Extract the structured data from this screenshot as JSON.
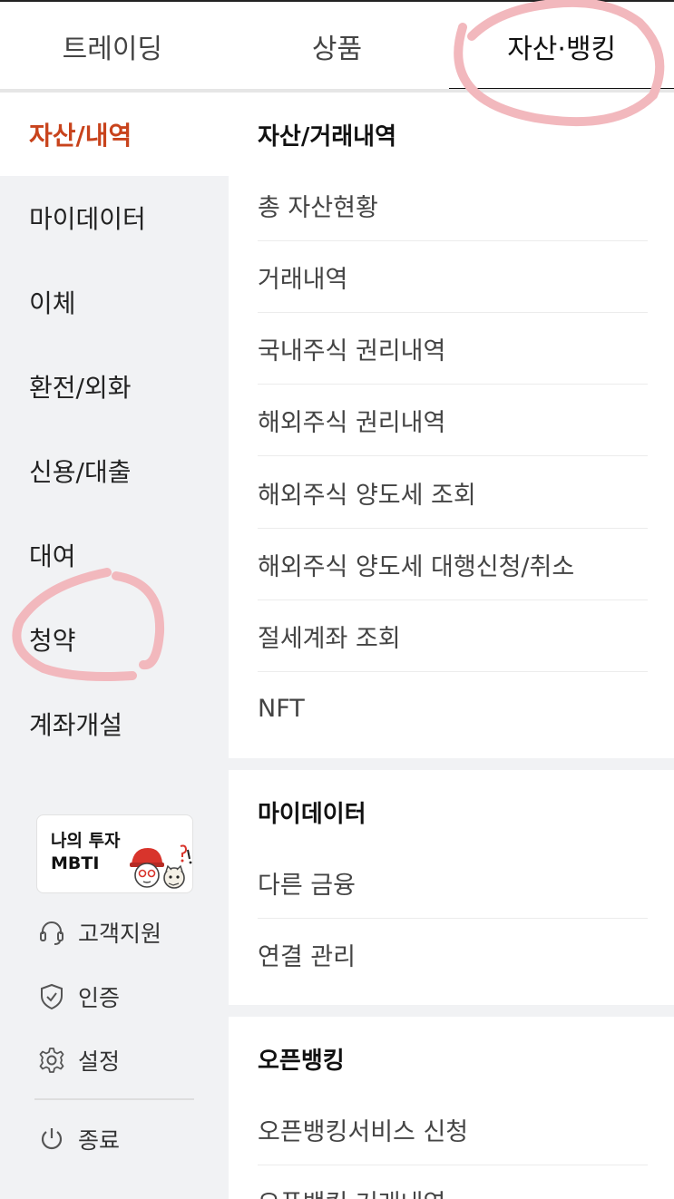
{
  "tabs": [
    {
      "label": "트레이딩"
    },
    {
      "label": "상품"
    },
    {
      "label": "자산·뱅킹"
    }
  ],
  "sidebar": {
    "items": [
      {
        "label": "자산/내역"
      },
      {
        "label": "마이데이터"
      },
      {
        "label": "이체"
      },
      {
        "label": "환전/외화"
      },
      {
        "label": "신용/대출"
      },
      {
        "label": "대여"
      },
      {
        "label": "청약"
      },
      {
        "label": "계좌개설"
      }
    ],
    "mbti": {
      "line1": "나의 투자",
      "line2": "MBTI"
    },
    "utilities": [
      {
        "label": "고객지원",
        "icon": "headset-icon"
      },
      {
        "label": "인증",
        "icon": "shield-check-icon"
      },
      {
        "label": "설정",
        "icon": "gear-icon"
      },
      {
        "label": "종료",
        "icon": "power-icon"
      }
    ]
  },
  "sections": [
    {
      "title": "자산/거래내역",
      "items": [
        "총 자산현황",
        "거래내역",
        "국내주식 권리내역",
        "해외주식 권리내역",
        "해외주식 양도세 조회",
        "해외주식 양도세 대행신청/취소",
        "절세계좌 조회",
        "NFT"
      ]
    },
    {
      "title": "마이데이터",
      "items": [
        "다른 금융",
        "연결 관리"
      ]
    },
    {
      "title": "오픈뱅킹",
      "items": [
        "오픈뱅킹서비스 신청",
        "오픈뱅킹 거래내역"
      ]
    }
  ],
  "colors": {
    "accent": "#c8431c",
    "sidebar_bg": "#f1f2f4",
    "annotation": "#f2b8bd"
  }
}
